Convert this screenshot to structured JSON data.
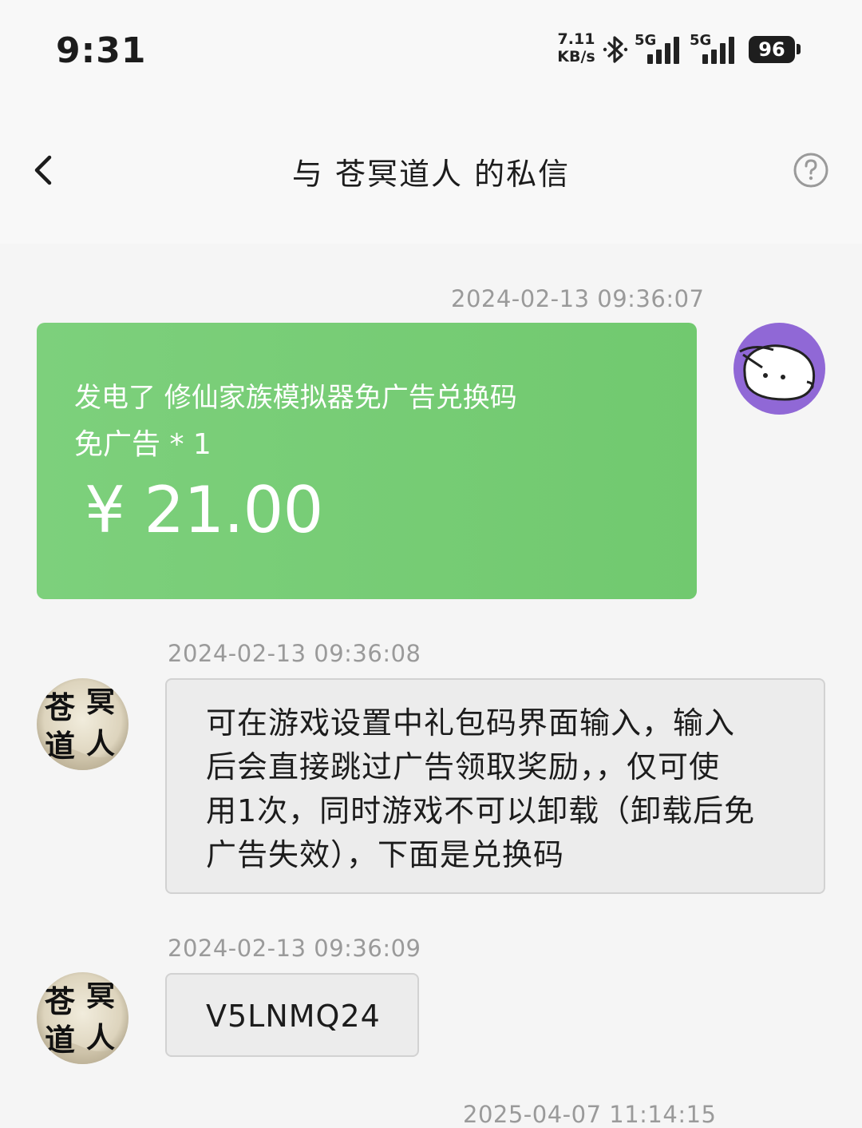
{
  "status_bar": {
    "time": "9:31",
    "net_speed_value": "7.11",
    "net_speed_unit": "KB/s",
    "sim1_label": "5G",
    "sim2_label": "5G",
    "battery_level": "96",
    "icons": [
      "bluetooth-icon",
      "signal-icon",
      "signal-icon",
      "battery-icon"
    ]
  },
  "header": {
    "title": "与 苍冥道人 的私信",
    "back_icon": "chevron-left-icon",
    "help_icon": "question-circle-icon"
  },
  "messages": [
    {
      "timestamp": "2024-02-13 09:36:07",
      "sender": "self",
      "type": "order_card",
      "card": {
        "title": "发电了 修仙家族模拟器免广告兑换码",
        "quantity": "免广告 * 1",
        "price": "¥ 21.00"
      }
    },
    {
      "timestamp": "2024-02-13 09:36:08",
      "sender": "苍冥道人",
      "type": "text",
      "lines": [
        "可在游戏设置中礼包码界面输入，输入",
        "后会直接跳过广告领取奖励，，仅可使",
        "用1次，同时游戏不可以卸载（卸载后免",
        "广告失效），下面是兑换码"
      ]
    },
    {
      "timestamp": "2024-02-13 09:36:09",
      "sender": "苍冥道人",
      "type": "text",
      "lines": [
        "V5LNMQ24"
      ]
    },
    {
      "timestamp": "2025-04-07 11:14:15",
      "sender": "self",
      "type": "text",
      "lines": []
    }
  ],
  "avatars": {
    "other_seal_text": [
      "苍",
      "冥",
      "道",
      "人"
    ]
  },
  "colors": {
    "card_green": "#76cc74",
    "self_avatar_purple": "#9068d6",
    "bubble_bg": "#ececec",
    "timestamp_gray": "#9a9a9a"
  }
}
